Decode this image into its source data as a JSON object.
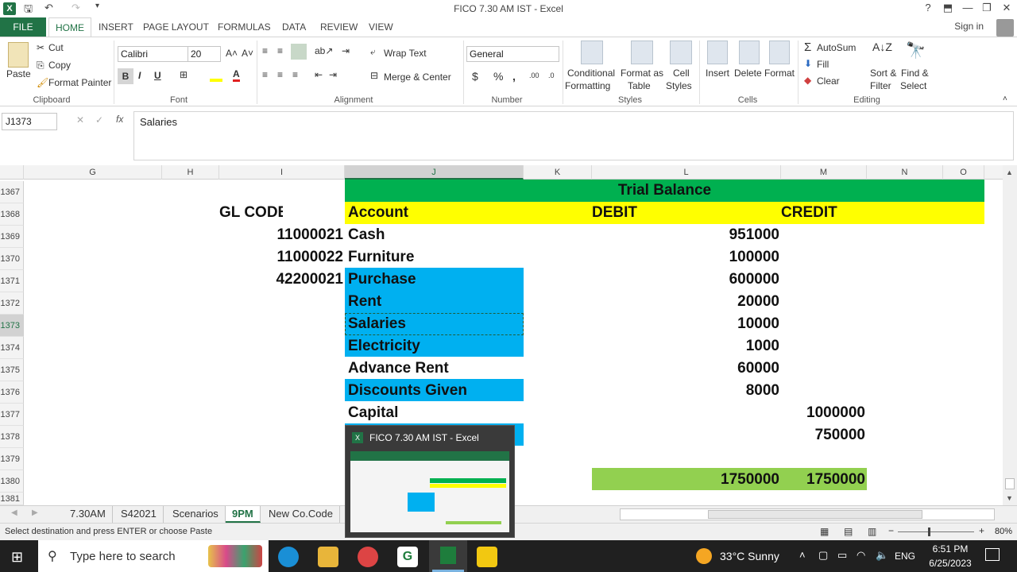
{
  "title_bar": {
    "title": "FICO 7.30 AM IST - Excel",
    "help": "?",
    "minimize": "—",
    "restore": "❐",
    "close": "✕"
  },
  "ribbon_tabs": [
    "FILE",
    "HOME",
    "INSERT",
    "PAGE LAYOUT",
    "FORMULAS",
    "DATA",
    "REVIEW",
    "VIEW"
  ],
  "sign_in": "Sign in",
  "clipboard": {
    "paste": "Paste",
    "cut": "Cut",
    "copy": "Copy",
    "format_painter": "Format Painter",
    "label": "Clipboard"
  },
  "font": {
    "name": "Calibri",
    "size": "20",
    "label": "Font",
    "bold": "B",
    "italic": "I",
    "underline": "U"
  },
  "alignment": {
    "wrap_text": "Wrap Text",
    "merge_center": "Merge & Center",
    "label": "Alignment"
  },
  "number": {
    "format": "General",
    "currency": "$",
    "percent": "%",
    "comma": ",",
    "label": "Number"
  },
  "styles": {
    "conditional": "Conditional",
    "formatting": "Formatting",
    "format_as": "Format as",
    "table": "Table",
    "cell": "Cell",
    "cell_styles": "Styles",
    "label": "Styles"
  },
  "cells": {
    "insert": "Insert",
    "delete": "Delete",
    "format": "Format",
    "label": "Cells"
  },
  "editing": {
    "autosum": "AutoSum",
    "fill": "Fill",
    "clear": "Clear",
    "sort1": "Sort &",
    "sort2": "Filter",
    "find1": "Find &",
    "find2": "Select",
    "label": "Editing"
  },
  "formula_bar": {
    "name_box": "J1373",
    "cancel": "✕",
    "enter": "✓",
    "fx": "fx",
    "content": "Salaries"
  },
  "columns": [
    "G",
    "H",
    "I",
    "J",
    "K",
    "L",
    "M",
    "N",
    "O"
  ],
  "rows": [
    "1367",
    "1368",
    "1369",
    "1370",
    "1371",
    "1372",
    "1373",
    "1374",
    "1375",
    "1376",
    "1377",
    "1378",
    "1379",
    "1380",
    "1381"
  ],
  "sheet": {
    "heading": "Trial Balance",
    "gl_code_header": "GL CODE",
    "account_header": "Account",
    "debit_header": "DEBIT",
    "credit_header": "CREDIT",
    "gl_codes": [
      "11000021",
      "11000022",
      "42200021"
    ],
    "accounts": [
      "Cash",
      "Furniture",
      "Purchase",
      "Rent",
      "Salaries",
      "Electricity",
      "Advance Rent",
      "Discounts Given",
      "Capital"
    ],
    "debits": [
      "951000",
      "100000",
      "600000",
      "20000",
      "10000",
      "1000",
      "60000",
      "8000"
    ],
    "credits": [
      "1000000",
      "750000"
    ],
    "total_debit": "1750000",
    "total_credit": "1750000"
  },
  "sheet_tabs": [
    "7.30AM",
    "S42021",
    "Scenarios",
    "9PM",
    "New Co.Code"
  ],
  "status": {
    "message": "Select destination and press ENTER or choose Paste",
    "zoom": "80%"
  },
  "preview": {
    "title": "FICO 7.30 AM IST - Excel"
  },
  "taskbar": {
    "search": "Type here to search",
    "weather": "33°C  Sunny",
    "lang": "ENG",
    "time": "6:51 PM",
    "date": "6/25/2023"
  }
}
